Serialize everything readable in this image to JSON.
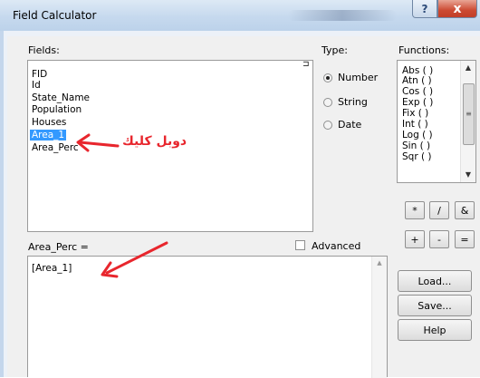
{
  "window": {
    "title": "Field Calculator",
    "help_glyph": "?",
    "close_glyph": "x"
  },
  "fields": {
    "label": "Fields:",
    "sort_glyph": "⊐",
    "items": [
      "FID",
      "Id",
      "State_Name",
      "Population",
      "Houses",
      "Area_1",
      "Area_Perc"
    ],
    "selected": "Area_1"
  },
  "type": {
    "label": "Type:",
    "options": [
      "Number",
      "String",
      "Date"
    ],
    "selected": "Number"
  },
  "functions": {
    "label": "Functions:",
    "items": [
      "Abs ( )",
      "Atn ( )",
      "Cos ( )",
      "Exp ( )",
      "Fix ( )",
      "Int ( )",
      "Log ( )",
      "Sin ( )",
      "Sqr ( )"
    ]
  },
  "operators": [
    "*",
    "/",
    "&",
    "+",
    "-",
    "="
  ],
  "expression": {
    "label": "Area_Perc =",
    "value": "[Area_1]",
    "advanced_label": "Advanced",
    "advanced_checked": false
  },
  "buttons": {
    "load": "Load...",
    "save": "Save...",
    "help": "Help"
  },
  "annotation": {
    "text": "دوبل كليك",
    "color": "#e8262d"
  }
}
